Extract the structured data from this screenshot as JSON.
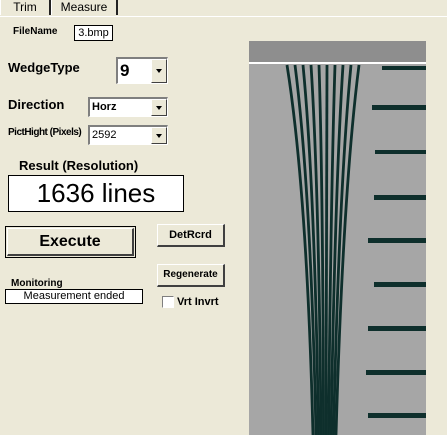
{
  "tabs": [
    {
      "label": "Trim"
    },
    {
      "label": "Measure"
    }
  ],
  "file": {
    "label": "FileName",
    "value": "3.bmp"
  },
  "wedge": {
    "label": "WedgeType",
    "value": "9"
  },
  "direction": {
    "label": "Direction",
    "value": "Horz"
  },
  "pict": {
    "label": "PictHight (Pixels)",
    "value": "2592"
  },
  "result": {
    "label": "Result (Resolution)",
    "value": "1636 lines"
  },
  "buttons": {
    "execute": "Execute",
    "detrcrd": "DetRcrd",
    "regenerate": "Regenerate"
  },
  "monitoring": {
    "label": "Monitoring",
    "status": "Measurement ended"
  },
  "checkbox": {
    "label": "Vrt Invrt",
    "checked": false
  },
  "colors": {
    "window": "#ece9d8",
    "image_bg": "#a6a6a6",
    "image_top": "#8e8e8e",
    "lines": "#0e2f2c"
  }
}
